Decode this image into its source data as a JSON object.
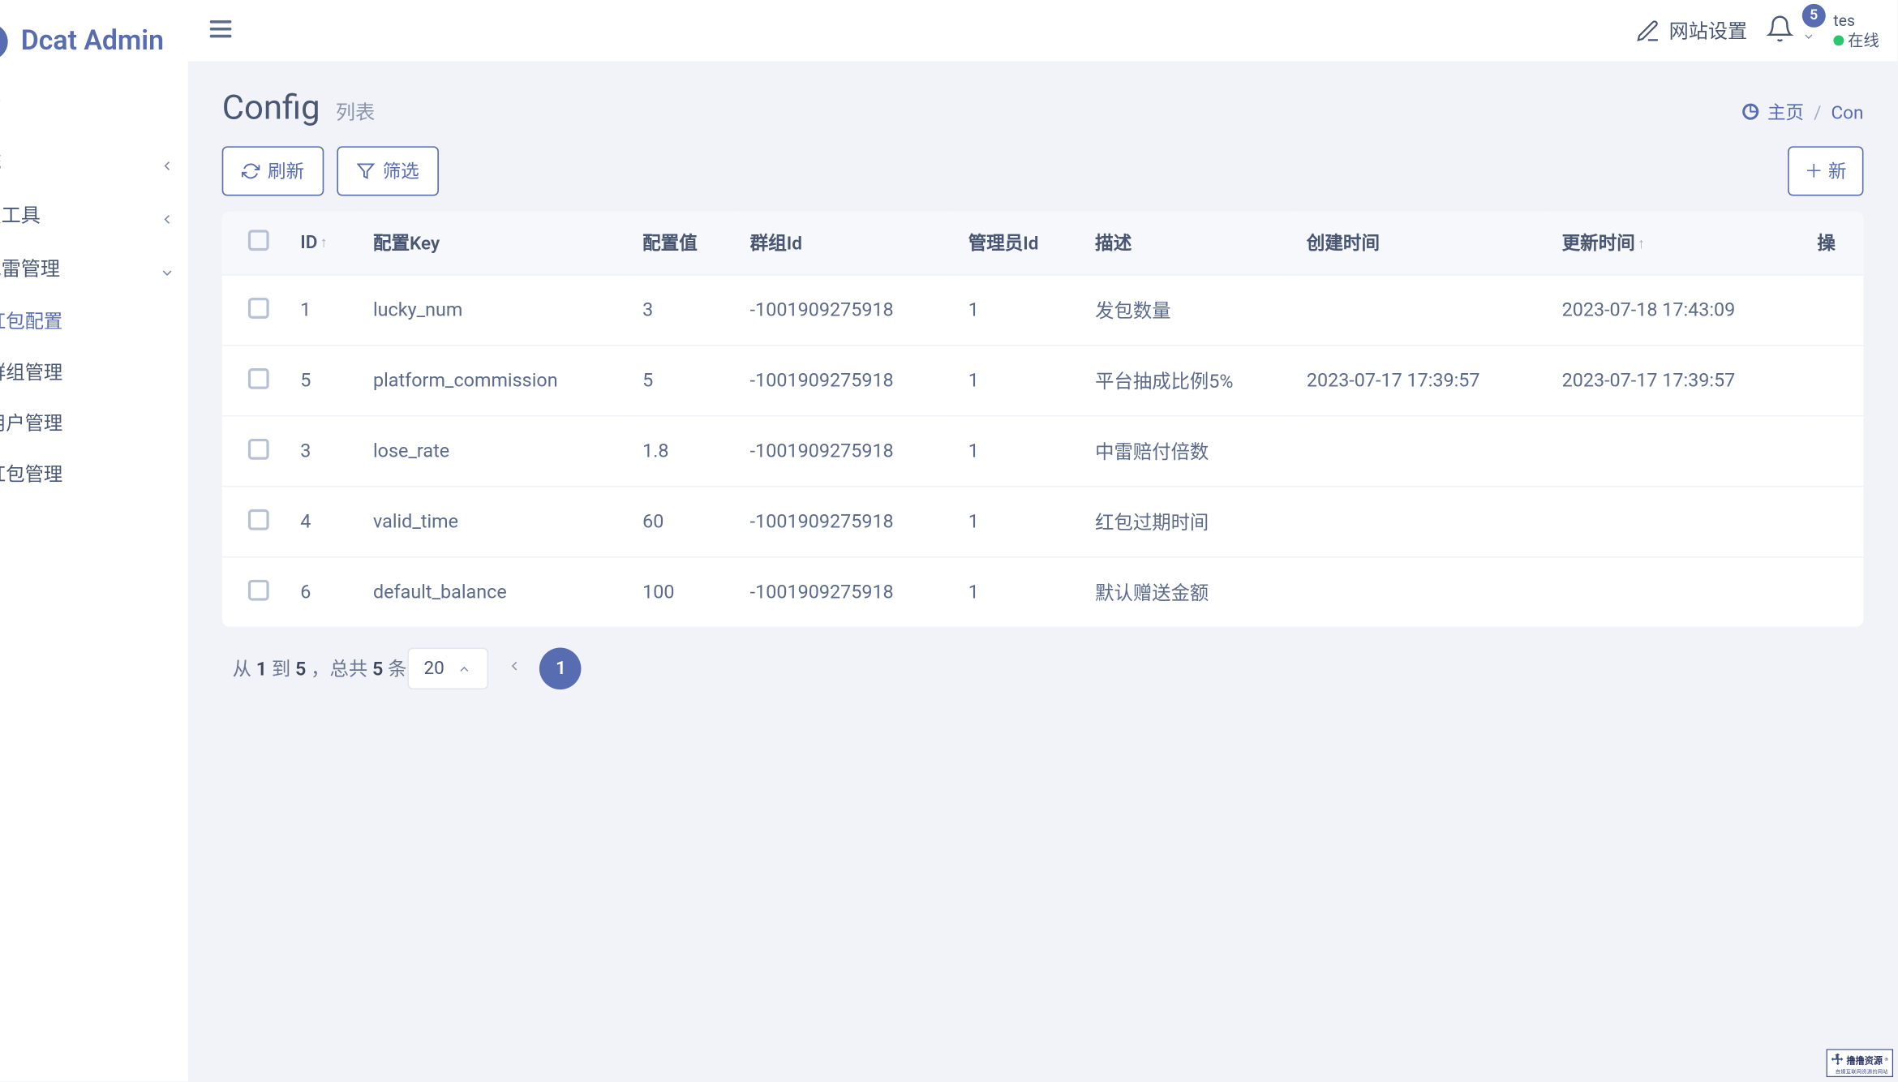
{
  "brand": "Dcat Admin",
  "topbar": {
    "site_settings": "网站设置",
    "notify_count": "5",
    "username": "tes",
    "status": "在线"
  },
  "sidebar": {
    "items": [
      {
        "label": "页",
        "type": "item"
      },
      {
        "label": "统",
        "type": "expand"
      },
      {
        "label": "发工具",
        "type": "expand"
      },
      {
        "label": "包雷管理",
        "type": "expand-open"
      }
    ],
    "sub": [
      {
        "label": "红包配置",
        "active": true
      },
      {
        "label": "群组管理",
        "active": false
      },
      {
        "label": "用户管理",
        "active": false
      },
      {
        "label": "红包管理",
        "active": false
      }
    ]
  },
  "page": {
    "title": "Config",
    "subtitle": "列表",
    "breadcrumb_home": "主页",
    "breadcrumb_current": "Con"
  },
  "toolbar": {
    "refresh": "刷新",
    "filter": "筛选",
    "new": "新"
  },
  "table": {
    "columns": {
      "id": "ID",
      "key": "配置Key",
      "value": "配置值",
      "group_id": "群组Id",
      "admin_id": "管理员Id",
      "desc": "描述",
      "created_at": "创建时间",
      "updated_at": "更新时间",
      "ops": "操"
    },
    "rows": [
      {
        "id": "1",
        "key": "lucky_num",
        "value": "3",
        "group_id": "-1001909275918",
        "admin_id": "1",
        "desc": "发包数量",
        "created_at": "",
        "updated_at": "2023-07-18 17:43:09"
      },
      {
        "id": "5",
        "key": "platform_commission",
        "value": "5",
        "group_id": "-1001909275918",
        "admin_id": "1",
        "desc": "平台抽成比例5%",
        "created_at": "2023-07-17 17:39:57",
        "updated_at": "2023-07-17 17:39:57"
      },
      {
        "id": "3",
        "key": "lose_rate",
        "value": "1.8",
        "group_id": "-1001909275918",
        "admin_id": "1",
        "desc": "中雷赔付倍数",
        "created_at": "",
        "updated_at": ""
      },
      {
        "id": "4",
        "key": "valid_time",
        "value": "60",
        "group_id": "-1001909275918",
        "admin_id": "1",
        "desc": "红包过期时间",
        "created_at": "",
        "updated_at": ""
      },
      {
        "id": "6",
        "key": "default_balance",
        "value": "100",
        "group_id": "-1001909275918",
        "admin_id": "1",
        "desc": "默认赠送金额",
        "created_at": "",
        "updated_at": ""
      }
    ]
  },
  "pagination": {
    "summary_prefix": "从 ",
    "summary_from": "1",
    "summary_mid": " 到 ",
    "summary_to": "5",
    "summary_total_prefix": " ，总共 ",
    "summary_total": "5",
    "summary_total_suffix": " 条",
    "page_size": "20",
    "current": "1"
  },
  "watermark": {
    "text": "撸撸资源",
    "sub": "自媒互联网资源的网站"
  }
}
